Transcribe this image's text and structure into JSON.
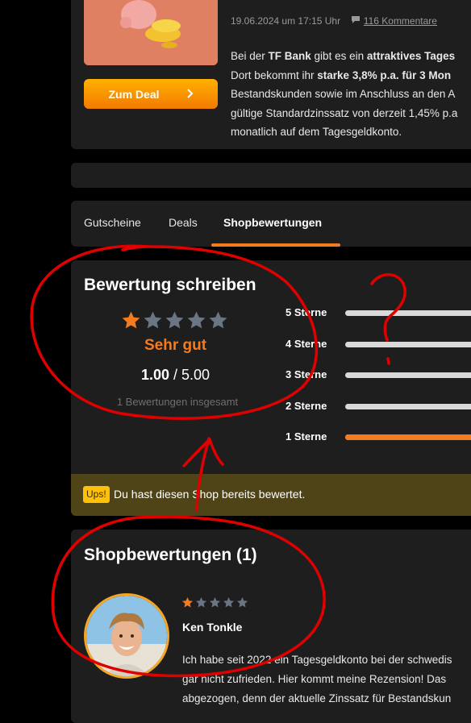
{
  "deal": {
    "button_label": "Zum Deal",
    "date": "19.06.2024 um 17:15 Uhr",
    "comments": "116 Kommentare",
    "body_lines": [
      [
        "Bei der ",
        "TF Bank",
        " gibt es ein ",
        "attraktives Tages"
      ],
      [
        "Dort bekommt ihr ",
        "starke 3,8% p.a. für 3 Mon"
      ],
      [
        "Bestandskunden sowie im Anschluss an den A"
      ],
      [
        "gültige Standardzinssatz von derzeit 1,45% p.a"
      ],
      [
        "monatlich auf dem Tagesgeldkonto."
      ]
    ]
  },
  "tabs": [
    {
      "label": "Gutscheine"
    },
    {
      "label": "Deals"
    },
    {
      "label": "Shopbewertungen",
      "active": true
    }
  ],
  "rating": {
    "title": "Bewertung schreiben",
    "stars": 1,
    "max_stars": 5,
    "label": "Sehr gut",
    "score": "1.00",
    "score_max": "/ 5.00",
    "count_text": "1 Bewertungen insgesamt",
    "bars": [
      {
        "label": "5 Sterne",
        "fill": 0
      },
      {
        "label": "4 Sterne",
        "fill": 0
      },
      {
        "label": "3 Sterne",
        "fill": 0
      },
      {
        "label": "2 Sterne",
        "fill": 0
      },
      {
        "label": "1 Sterne",
        "fill": 1
      }
    ]
  },
  "notice": {
    "badge": "Ups!",
    "text": "Du hast diesen Shop bereits bewertet."
  },
  "reviews": {
    "title": "Shopbewertungen (1)",
    "items": [
      {
        "stars": 1,
        "name": "Ken Tonkle",
        "text_lines": [
          "Ich habe seit 2022 ein Tagesgeldkonto bei der schwedis",
          "gar nicht zufrieden. Hier kommt meine Rezension! Das",
          "abgezogen, denn der aktuelle Zinssatz für Bestandskun"
        ]
      }
    ]
  },
  "annotation": {
    "question_mark": "?"
  },
  "colors": {
    "accent": "#f47b20",
    "star_empty": "#6b7685",
    "annotation": "#e00000",
    "notice_bg": "#4f4318",
    "badge": "#ffc107"
  }
}
